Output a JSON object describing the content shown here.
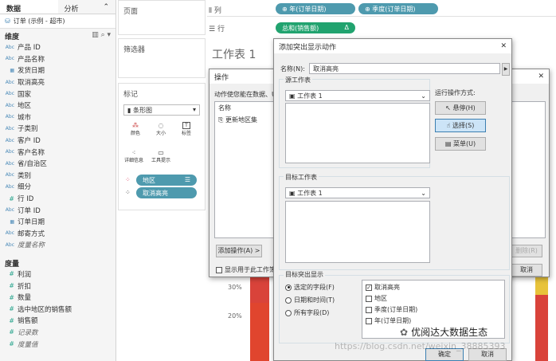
{
  "tabs": {
    "data": "数据",
    "analysis": "分析"
  },
  "datasource": "订单 (示例 - 超市)",
  "dimensions": {
    "header": "维度",
    "fields": [
      {
        "type": "Abc",
        "name": "产品 ID"
      },
      {
        "type": "Abc",
        "name": "产品名称"
      },
      {
        "type": "date",
        "name": "发货日期"
      },
      {
        "type": "Abc",
        "name": "取消高亮"
      },
      {
        "type": "Abc",
        "name": "国家"
      },
      {
        "type": "Abc",
        "name": "地区"
      },
      {
        "type": "Abc",
        "name": "城市"
      },
      {
        "type": "Abc",
        "name": "子类别"
      },
      {
        "type": "Abc",
        "name": "客户 ID"
      },
      {
        "type": "Abc",
        "name": "客户名称"
      },
      {
        "type": "Abc",
        "name": "省/自治区"
      },
      {
        "type": "Abc",
        "name": "类别"
      },
      {
        "type": "Abc",
        "name": "细分"
      },
      {
        "type": "#",
        "name": "行 ID"
      },
      {
        "type": "Abc",
        "name": "订单 ID"
      },
      {
        "type": "date",
        "name": "订单日期"
      },
      {
        "type": "Abc",
        "name": "邮寄方式"
      },
      {
        "type": "Abc",
        "name": "度量名称",
        "italic": true
      }
    ]
  },
  "measures": {
    "header": "度量",
    "fields": [
      {
        "type": "#",
        "name": "利润"
      },
      {
        "type": "#",
        "name": "折扣"
      },
      {
        "type": "#",
        "name": "数量"
      },
      {
        "type": "#",
        "name": "选中地区的销售额"
      },
      {
        "type": "#",
        "name": "销售额"
      },
      {
        "type": "#",
        "name": "记录数",
        "italic": true
      },
      {
        "type": "#",
        "name": "度量值",
        "italic": true
      }
    ]
  },
  "shelves": {
    "pages": "页面",
    "filters": "筛选器",
    "marks": "标记",
    "columns_label": "列",
    "rows_label": "行",
    "columns_pills": [
      "年(订单日期)",
      "季度(订单日期)"
    ],
    "rows_pills": [
      "总和(销售额)"
    ],
    "mark_type": "条形图",
    "mark_buttons": [
      "颜色",
      "大小",
      "标签",
      "详细信息",
      "工具提示"
    ],
    "mark_pills": [
      "地区",
      "取消高亮"
    ]
  },
  "sheet_title": "工作表 1",
  "chart_pct": [
    "30%",
    "20%"
  ],
  "actions_dialog": {
    "title": "操作",
    "hint": "动作使您能在数据、U",
    "col_name": "名称",
    "items": [
      "更新地区集"
    ],
    "add_button": "添加操作(A) >",
    "show_all": "显示用于此工作簿",
    "delete_button": "删除(R)",
    "cancel_button": "取消"
  },
  "highlight_dialog": {
    "title": "添加突出显示动作",
    "name_label": "名称(N):",
    "name_value": "取消高亮",
    "source_label": "源工作表",
    "source_sheet": "工作表 1",
    "run_label": "运行操作方式:",
    "run_options": [
      "悬停(H)",
      "选择(S)",
      "菜单(U)"
    ],
    "target_label": "目标工作表",
    "target_sheet": "工作表 1",
    "target_highlight_label": "目标突出显示",
    "radios": [
      "选定的字段(F)",
      "日期和时间(T)",
      "所有字段(D)"
    ],
    "checkboxes": [
      {
        "label": "取消高亮",
        "checked": true
      },
      {
        "label": "地区",
        "checked": false
      },
      {
        "label": "季度(订单日期)",
        "checked": false
      },
      {
        "label": "年(订单日期)",
        "checked": false
      }
    ],
    "ok_button": "确定",
    "cancel_button": "取消"
  },
  "watermark": {
    "brand": "优阅达大数据生态",
    "url": "https://blog.csdn.net/weixin_38885393"
  }
}
